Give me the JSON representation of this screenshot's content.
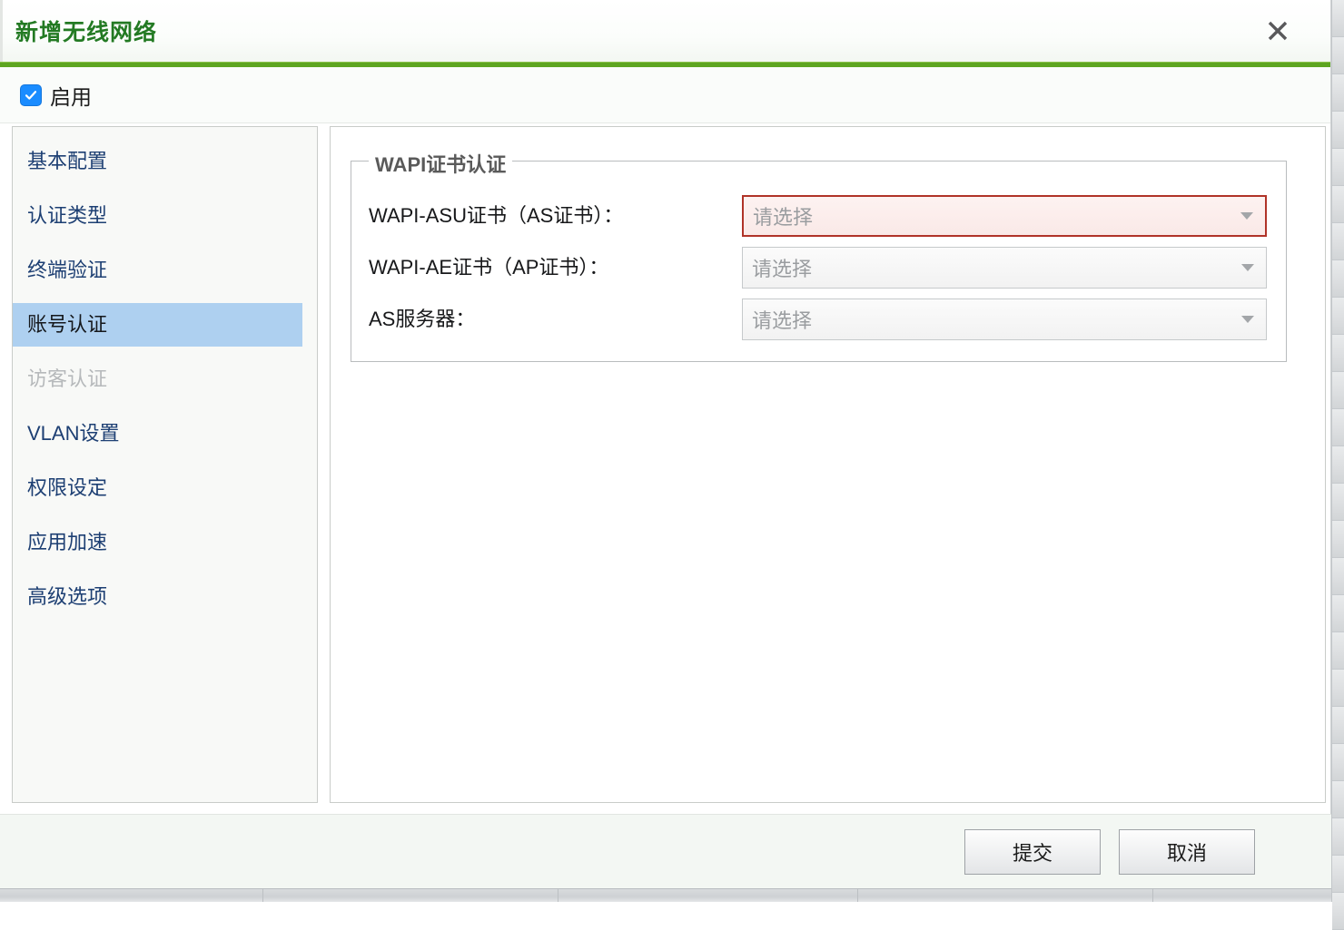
{
  "dialog": {
    "title": "新增无线网络",
    "close_icon": "close-icon"
  },
  "enable": {
    "label": "启用",
    "checked": true,
    "check_icon": "check-icon"
  },
  "sidebar": {
    "items": [
      {
        "label": "基本配置",
        "state": "normal"
      },
      {
        "label": "认证类型",
        "state": "normal"
      },
      {
        "label": "终端验证",
        "state": "normal"
      },
      {
        "label": "账号认证",
        "state": "selected"
      },
      {
        "label": "访客认证",
        "state": "disabled"
      },
      {
        "label": "VLAN设置",
        "state": "normal"
      },
      {
        "label": "权限设定",
        "state": "normal"
      },
      {
        "label": "应用加速",
        "state": "normal"
      },
      {
        "label": "高级选项",
        "state": "normal"
      }
    ]
  },
  "content": {
    "fieldset_legend": "WAPI证书认证",
    "fields": [
      {
        "label": "WAPI-ASU证书（AS证书）：",
        "value": "请选择",
        "placeholder": "请选择",
        "state": "error",
        "arrow_icon": "chevron-down-icon"
      },
      {
        "label": "WAPI-AE证书（AP证书）：",
        "value": "请选择",
        "placeholder": "请选择",
        "state": "normal",
        "arrow_icon": "chevron-down-icon"
      },
      {
        "label": "AS服务器：",
        "value": "请选择",
        "placeholder": "请选择",
        "state": "normal",
        "arrow_icon": "chevron-down-icon"
      }
    ]
  },
  "footer": {
    "submit_label": "提交",
    "cancel_label": "取消"
  },
  "colors": {
    "title_green": "#237a23",
    "rule_green": "#5da520",
    "selected_blue": "#aed0f0",
    "error_red": "#b03328",
    "sidebar_text": "#1d3f73",
    "disabled_text": "#b6b9bb"
  }
}
